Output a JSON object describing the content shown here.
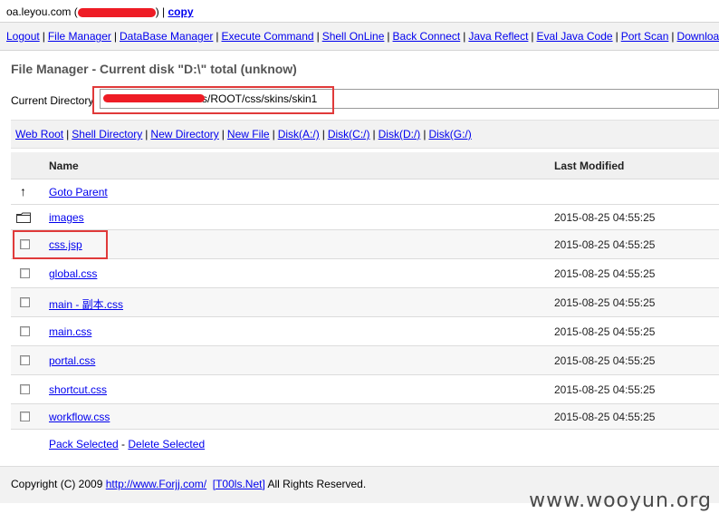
{
  "topbar": {
    "host": "oa.leyou.com (",
    "host_close": ") |",
    "copy_label": "copy"
  },
  "nav": {
    "items": [
      "Logout",
      "File Manager",
      "DataBase Manager",
      "Execute Command",
      "Shell OnLine",
      "Back Connect",
      "Java Reflect",
      "Eval Java Code",
      "Port Scan",
      "Download"
    ]
  },
  "page": {
    "title": "File Manager - Current disk \"D:\\\" total (unknow)",
    "current_dir_label": "Current Directory",
    "current_dir_value": "s/ROOT/css/skins/skin1"
  },
  "links": {
    "items": [
      "Web Root",
      "Shell Directory",
      "New Directory",
      "New File",
      "Disk(A:/)",
      "Disk(C:/)",
      "Disk(D:/)",
      "Disk(G:/)"
    ]
  },
  "table": {
    "headers": {
      "name": "Name",
      "modified": "Last Modified"
    },
    "goto_parent": "Goto Parent",
    "rows": [
      {
        "name": "images",
        "modified": "2015-08-25 04:55:25",
        "type": "folder-icon"
      },
      {
        "name": "css.jsp",
        "modified": "2015-08-25 04:55:25",
        "type": "checkbox"
      },
      {
        "name": "global.css",
        "modified": "2015-08-25 04:55:25",
        "type": "checkbox"
      },
      {
        "name": "main - 副本.css",
        "modified": "2015-08-25 04:55:25",
        "type": "checkbox"
      },
      {
        "name": "main.css",
        "modified": "2015-08-25 04:55:25",
        "type": "checkbox"
      },
      {
        "name": "portal.css",
        "modified": "2015-08-25 04:55:25",
        "type": "checkbox"
      },
      {
        "name": "shortcut.css",
        "modified": "2015-08-25 04:55:25",
        "type": "checkbox"
      },
      {
        "name": "workflow.css",
        "modified": "2015-08-25 04:55:25",
        "type": "checkbox"
      }
    ],
    "pack_selected": "Pack Selected",
    "action_sep": " - ",
    "delete_selected": "Delete Selected"
  },
  "footer": {
    "prefix": "Copyright (C) 2009",
    "url": "http://www.Forjj.com/",
    "bracket_link": "[T00ls.Net]",
    "suffix": "All Rights Reserved."
  },
  "watermark": "www.wooyun.org",
  "colors": {
    "link": "#0000ee",
    "highlight_box": "#e03a3a",
    "redaction": "#ee1c25"
  }
}
